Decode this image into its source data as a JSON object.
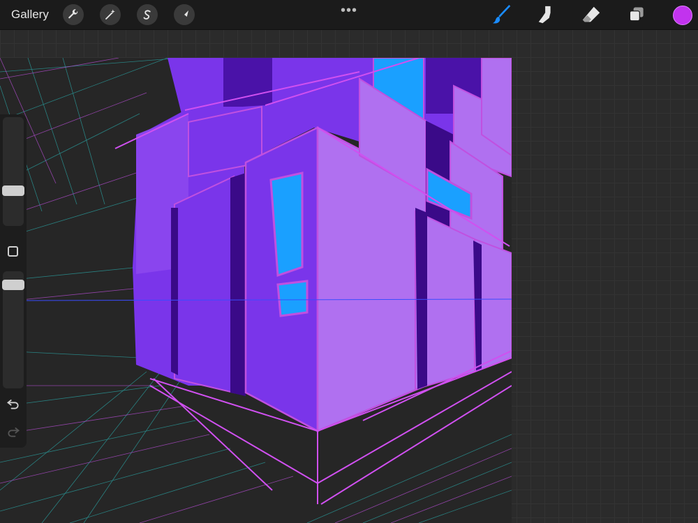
{
  "topbar": {
    "gallery_label": "Gallery",
    "left_tools": [
      {
        "name": "actions",
        "icon": "wrench-icon"
      },
      {
        "name": "adjustments",
        "icon": "magic-wand-icon"
      },
      {
        "name": "selection",
        "icon": "selection-s-icon"
      },
      {
        "name": "transform",
        "icon": "arrow-cursor-icon"
      }
    ],
    "more_label": "•••",
    "right_tools": [
      {
        "name": "brush",
        "icon": "brush-icon",
        "active": true
      },
      {
        "name": "smudge",
        "icon": "smudge-finger-icon",
        "active": false
      },
      {
        "name": "eraser",
        "icon": "eraser-icon",
        "active": false
      },
      {
        "name": "layers",
        "icon": "layers-icon",
        "active": false
      }
    ],
    "current_color": "#c233ee"
  },
  "sidebar": {
    "brush_size_level": 0.47,
    "opacity_level": 0.9,
    "undo_icon": "undo-icon",
    "redo_icon": "redo-icon"
  },
  "colors": {
    "accent_blue": "#1a8cff",
    "purple_dark": "#6a2be0",
    "purple_light": "#b070f0",
    "window_blue": "#1aa0ff",
    "grid_pink": "#c050e0",
    "grid_teal": "#2aa0a0"
  }
}
